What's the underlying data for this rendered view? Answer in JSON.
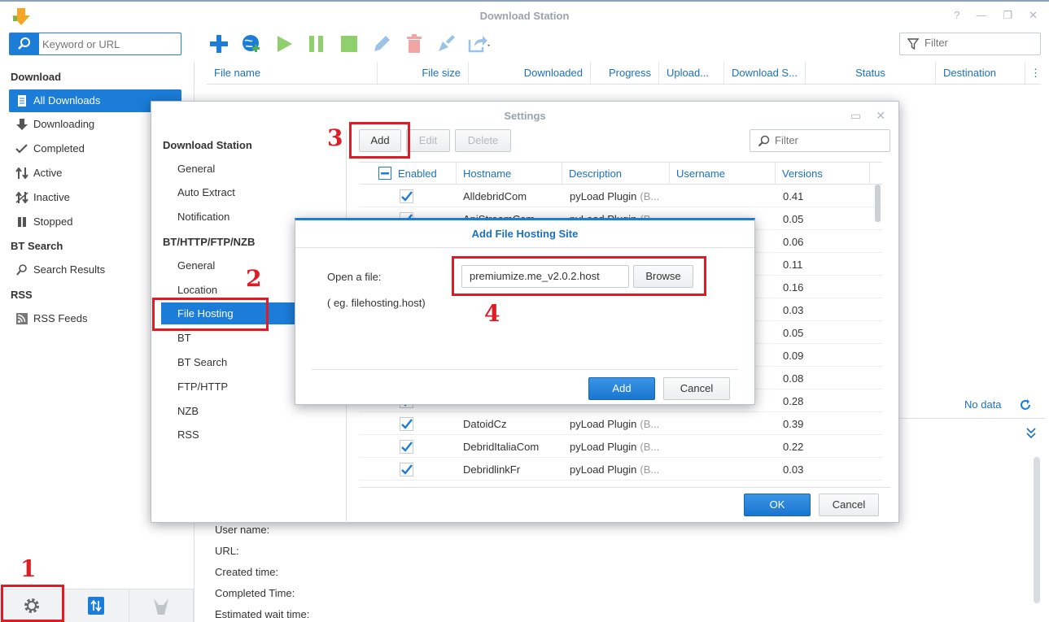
{
  "app": {
    "title": "Download Station",
    "icon": "download-station-icon"
  },
  "toolbar": {
    "search_placeholder": "Keyword or URL",
    "filter_placeholder": "Filter",
    "icons": [
      "add-icon",
      "add-url-icon",
      "resume-icon",
      "pause-icon",
      "stop-icon",
      "edit-icon",
      "delete-icon",
      "clear-icon",
      "share-icon"
    ]
  },
  "sidebar": {
    "sections": {
      "download": "Download",
      "bt_search": "BT Search",
      "rss": "RSS"
    },
    "items": [
      {
        "label": "All Downloads",
        "icon": "document-icon",
        "selected": true
      },
      {
        "label": "Downloading",
        "icon": "arrow-down-icon"
      },
      {
        "label": "Completed",
        "icon": "check-icon"
      },
      {
        "label": "Active",
        "icon": "updown-icon"
      },
      {
        "label": "Inactive",
        "icon": "inactive-icon"
      },
      {
        "label": "Stopped",
        "icon": "pause-icon"
      },
      {
        "label": "Search Results",
        "icon": "search-icon"
      },
      {
        "label": "RSS Feeds",
        "icon": "rss-icon"
      }
    ],
    "bottom_icons": [
      "settings-gear-icon",
      "transfer-icon",
      "emule-icon"
    ]
  },
  "main": {
    "columns": [
      "File name",
      "File size",
      "Downloaded",
      "Progress",
      "Upload...",
      "Download S...",
      "Status",
      "Destination"
    ],
    "no_data": "No data",
    "details": [
      "User name:",
      "URL:",
      "Created time:",
      "Completed Time:",
      "Estimated wait time:"
    ]
  },
  "settings": {
    "title": "Settings",
    "nav": {
      "section1": "Download Station",
      "s1_items": [
        "General",
        "Auto Extract",
        "Notification"
      ],
      "section2": "BT/HTTP/FTP/NZB",
      "s2_items": [
        "General",
        "Location",
        "File Hosting",
        "BT",
        "BT Search",
        "FTP/HTTP",
        "NZB",
        "RSS"
      ]
    },
    "buttons": {
      "add": "Add",
      "edit": "Edit",
      "delete": "Delete",
      "ok": "OK",
      "cancel": "Cancel"
    },
    "filter_placeholder": "Filter",
    "grid": {
      "columns": [
        "Enabled",
        "Hostname",
        "Description",
        "Username",
        "Versions"
      ],
      "rows": [
        {
          "host": "AlldebridCom",
          "desc": "pyLoad Plugin",
          "desc_tail": "(B...",
          "version": "0.41"
        },
        {
          "host": "ApiStreamCom",
          "desc": "pyLoad Plugin",
          "desc_tail": "(B...",
          "version": "0.05"
        },
        {
          "version": "0.06"
        },
        {
          "version": "0.11"
        },
        {
          "version": "0.16"
        },
        {
          "version": "0.03"
        },
        {
          "version": "0.05"
        },
        {
          "version": "0.09"
        },
        {
          "version": "0.08"
        },
        {
          "version": "0.28"
        },
        {
          "host": "DatoidCz",
          "desc": "pyLoad Plugin",
          "desc_tail": "(B...",
          "version": "0.39"
        },
        {
          "host": "DebridItaliaCom",
          "desc": "pyLoad Plugin",
          "desc_tail": "(B...",
          "version": "0.22"
        },
        {
          "host": "DebridlinkFr",
          "desc": "pyLoad Plugin",
          "desc_tail": "(B...",
          "version": "0.03"
        }
      ]
    }
  },
  "add_host_dialog": {
    "title": "Add File Hosting Site",
    "open_label": "Open a file:",
    "hint": "( eg. filehosting.host)",
    "file_value": "premiumize.me_v2.0.2.host",
    "browse": "Browse",
    "add": "Add",
    "cancel": "Cancel"
  },
  "annotations": {
    "step1": "1",
    "step2": "2",
    "step3": "3",
    "step4": "4",
    "color": "#e01b24"
  }
}
